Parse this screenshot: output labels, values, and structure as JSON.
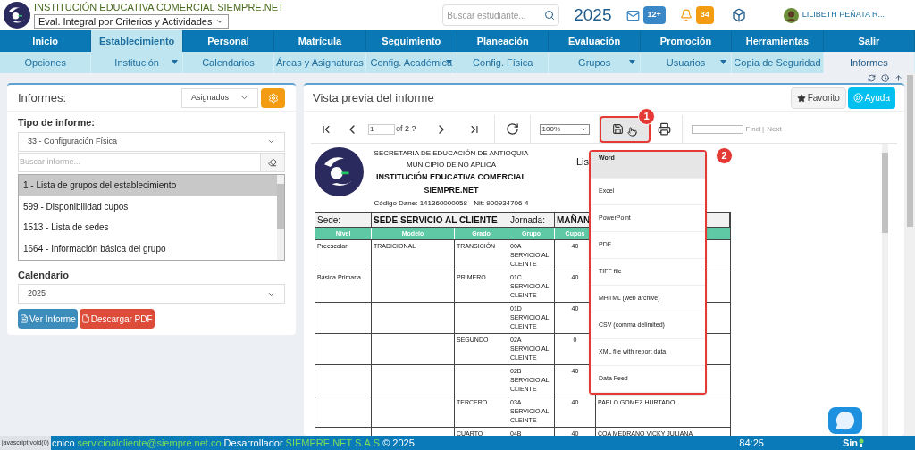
{
  "header": {
    "school": "INSTITUCIÓN EDUCATIVA COMERCIAL SIEMPRE.NET",
    "mode_select": "Eval. Integral por Criterios y Actividades",
    "search_placeholder": "Buscar estudiante...",
    "year": "2025",
    "messages_badge": "12+",
    "alerts_badge": "34",
    "user": "LILIBETH PEÑATA R..."
  },
  "main_nav": [
    {
      "label": "Inicio",
      "selected": false
    },
    {
      "label": "Establecimiento",
      "selected": true
    },
    {
      "label": "Personal",
      "selected": false
    },
    {
      "label": "Matrícula",
      "selected": false
    },
    {
      "label": "Seguimiento",
      "selected": false
    },
    {
      "label": "Planeación",
      "selected": false
    },
    {
      "label": "Evaluación",
      "selected": false
    },
    {
      "label": "Promoción",
      "selected": false
    },
    {
      "label": "Herramientas",
      "selected": false
    },
    {
      "label": "Salir",
      "selected": false
    }
  ],
  "sub_nav": [
    {
      "label": "Opciones",
      "has_menu": false,
      "selected": false
    },
    {
      "label": "Institución",
      "has_menu": true,
      "selected": false
    },
    {
      "label": "Calendarios",
      "has_menu": false,
      "selected": false
    },
    {
      "label": "Áreas y Asignaturas",
      "has_menu": false,
      "selected": false
    },
    {
      "label": "Config. Académica",
      "has_menu": true,
      "selected": false
    },
    {
      "label": "Config. Física",
      "has_menu": false,
      "selected": false
    },
    {
      "label": "Grupos",
      "has_menu": true,
      "selected": false
    },
    {
      "label": "Usuarios",
      "has_menu": true,
      "selected": false
    },
    {
      "label": "Copia de Seguridad",
      "has_menu": false,
      "selected": false
    },
    {
      "label": "Informes",
      "has_menu": false,
      "selected": true
    }
  ],
  "left_panel": {
    "title": "Informes:",
    "filter": "Asignados",
    "type_label": "Tipo de informe:",
    "type_value": "33 - Configuración Física",
    "search_placeholder": "Buscar informe...",
    "reports": [
      {
        "label": "1 - Lista de grupos del establecimiento",
        "selected": true
      },
      {
        "label": "599 - Disponibilidad cupos",
        "selected": false
      },
      {
        "label": "1513 - Lista de sedes",
        "selected": false
      },
      {
        "label": "1664 - Información básica del grupo",
        "selected": false
      }
    ],
    "calendar_label": "Calendario",
    "calendar_value": "2025",
    "buttons": [
      {
        "label": "Ver Informe",
        "kind": "primary"
      },
      {
        "label": "Descargar PDF",
        "kind": "danger"
      }
    ]
  },
  "preview": {
    "title": "Vista previa del informe",
    "buttons": [
      {
        "label": "Favorito",
        "kind": "default"
      },
      {
        "label": "Ayuda",
        "kind": "info"
      }
    ],
    "toolbar": {
      "page": "1",
      "page_count": "of 2 ?",
      "zoom": "100%",
      "find": "Find",
      "separator": "|",
      "next": "Next"
    },
    "report": {
      "lines": [
        "SECRETARIA DE EDUCACIÓN DE ANTIOQUIA",
        "MUNICIPIO DE NO APLICA"
      ],
      "institution": "INSTITUCIÓN EDUCATIVA COMERCIAL SIEMPRE.NET",
      "codes": "Código Dane: 141360000058 - Nit: 900934706-4",
      "title": "Lis",
      "sede_row": [
        "Sede:",
        "SEDE SERVICIO AL CLIENTE",
        "Jornada:",
        "MAÑAN"
      ],
      "columns": [
        "Nivel",
        "Modelo",
        "Grado",
        "Grupo",
        "Cupos"
      ],
      "rows": [
        [
          "Preescolar",
          "TRADICIONAL",
          "TRANSICIÓN",
          "00A SERVICIO AL CLEINTE",
          "40",
          ""
        ],
        [
          "Básica Primaria",
          "",
          "PRIMERO",
          "01C SERVICIO AL CLEINTE",
          "40",
          ""
        ],
        [
          "",
          "",
          "",
          "01D SERVICIO AL CLEINTE",
          "40",
          ""
        ],
        [
          "",
          "",
          "SEGUNDO",
          "02A SERVICIO AL CLEINTE",
          "0",
          ""
        ],
        [
          "",
          "",
          "",
          "02B SERVICIO AL CLIENTE",
          "40",
          ""
        ],
        [
          "",
          "",
          "TERCERO",
          "03A SERVICIO AL CLEINTE",
          "40",
          "PABLO GOMEZ HURTADO"
        ],
        [
          "",
          "",
          "CUARTO",
          "04B",
          "40",
          "COA MEDRANO VICKY JULIANA"
        ]
      ]
    },
    "export_menu": [
      {
        "label": "Word",
        "selected": true
      },
      {
        "label": "Excel",
        "selected": false
      },
      {
        "label": "PowerPoint",
        "selected": false
      },
      {
        "label": "PDF",
        "selected": false
      },
      {
        "label": "TIFF file",
        "selected": false
      },
      {
        "label": "MHTML (web archive)",
        "selected": false
      },
      {
        "label": "CSV (comma delimited)",
        "selected": false
      },
      {
        "label": "XML file with report data",
        "selected": false
      },
      {
        "label": "Data Feed",
        "selected": false
      }
    ],
    "callouts": [
      "1",
      "2"
    ]
  },
  "footer": {
    "status_tip": "javascript:void(0)",
    "support": "cnico",
    "email": "servicioalcliente@siempre.net.co",
    "developer_label": "Desarrollador",
    "developer": "SIEMPRE.NET S.A.S",
    "copyright": "© 2025",
    "timer": "84:25",
    "brand": "Sin"
  }
}
